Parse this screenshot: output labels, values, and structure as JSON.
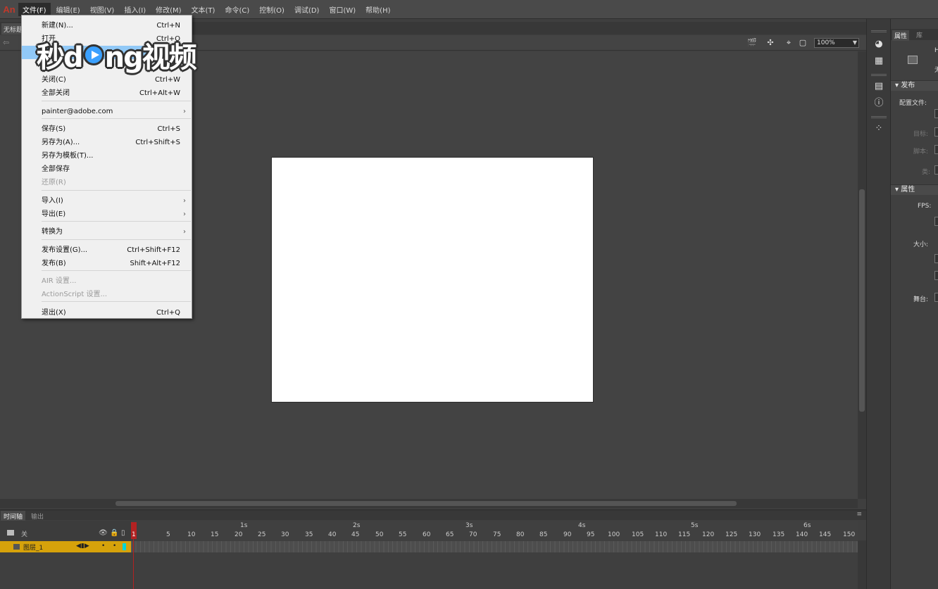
{
  "app": {
    "logo": "An"
  },
  "menubar": {
    "items": [
      "文件(F)",
      "编辑(E)",
      "视图(V)",
      "插入(I)",
      "修改(M)",
      "文本(T)",
      "命令(C)",
      "控制(O)",
      "调试(D)",
      "窗口(W)",
      "帮助(H)"
    ],
    "active_index": 0
  },
  "document": {
    "tab_label": "无标题"
  },
  "editbar": {
    "zoom": "100%"
  },
  "file_menu": {
    "items": [
      {
        "label": "新建(N)...",
        "shortcut": "Ctrl+N"
      },
      {
        "label": "打开",
        "shortcut": "Ctrl+O"
      },
      {
        "label": "",
        "shortcut": "",
        "highlighted": true
      },
      {
        "label": "关闭(C)",
        "shortcut": "Ctrl+W"
      },
      {
        "label": "全部关闭",
        "shortcut": "Ctrl+Alt+W"
      },
      {
        "label": "painter@adobe.com",
        "submenu": true
      },
      {
        "label": "保存(S)",
        "shortcut": "Ctrl+S"
      },
      {
        "label": "另存为(A)...",
        "shortcut": "Ctrl+Shift+S"
      },
      {
        "label": "另存为模板(T)..."
      },
      {
        "label": "全部保存"
      },
      {
        "label": "还原(R)",
        "disabled": true
      },
      {
        "label": "导入(I)",
        "submenu": true
      },
      {
        "label": "导出(E)",
        "submenu": true
      },
      {
        "label": "转换为",
        "submenu": true
      },
      {
        "label": "发布设置(G)...",
        "shortcut": "Ctrl+Shift+F12"
      },
      {
        "label": "发布(B)",
        "shortcut": "Shift+Alt+F12"
      },
      {
        "label": "AIR 设置...",
        "disabled": true
      },
      {
        "label": "ActionScript 设置...",
        "disabled": true
      },
      {
        "label": "退出(X)",
        "shortcut": "Ctrl+Q"
      }
    ]
  },
  "watermark": {
    "text_left": "秒d",
    "text_right": "ng视频"
  },
  "timeline": {
    "tabs": [
      "时间轴",
      "输出"
    ],
    "layer_header_label": "关",
    "seconds": [
      "1s",
      "2s",
      "3s",
      "4s",
      "5s",
      "6s"
    ],
    "frame_numbers": [
      "5",
      "10",
      "15",
      "20",
      "25",
      "30",
      "35",
      "40",
      "45",
      "50",
      "55",
      "60",
      "65",
      "70",
      "75",
      "80",
      "85",
      "90",
      "95",
      "100",
      "105",
      "110",
      "115",
      "120",
      "125",
      "130",
      "135",
      "140",
      "145",
      "150"
    ],
    "current_frame": "1",
    "layer_name": "图层_1",
    "layer_color": "#00d6d6"
  },
  "properties": {
    "tabs": [
      "属性",
      "库"
    ],
    "doc_label_1": "H",
    "doc_label_2": "无",
    "publish_header": "发布",
    "profile_label": "配置文件:",
    "target_label": "目标:",
    "script_label": "脚本:",
    "class_label": "类:",
    "props_header": "属性",
    "fps_label": "FPS:",
    "size_label": "大小:",
    "stage_label": "舞台:"
  },
  "colors": {
    "accent": "#d6a20b",
    "playhead": "#b32222",
    "stage": "#ffffff",
    "menu_highlight": "#91c9f7"
  }
}
